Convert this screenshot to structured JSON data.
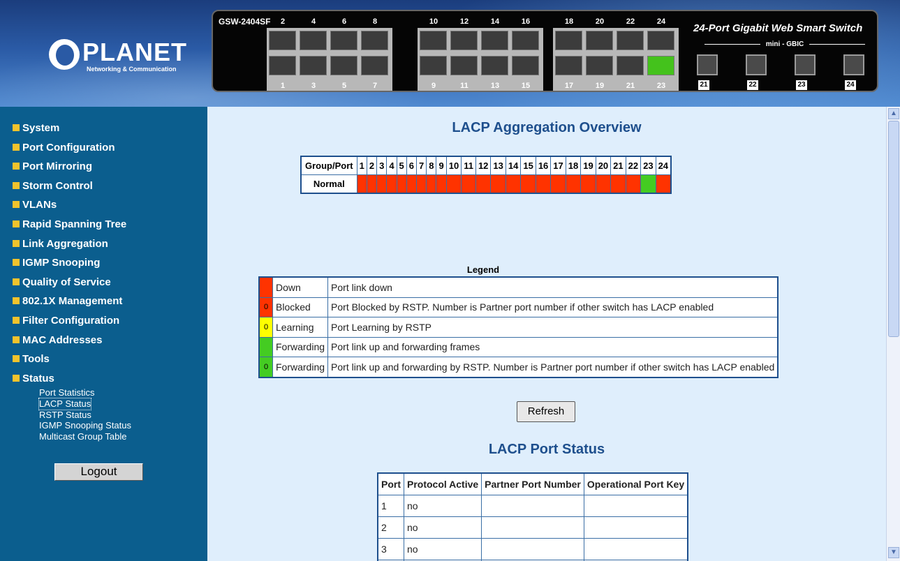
{
  "brand": {
    "logo_text": "PLANET",
    "logo_tagline": "Networking & Communication"
  },
  "device": {
    "model": "GSW-2404SF",
    "title": "24-Port Gigabit Web Smart Switch",
    "mini_gbic_label": "mini - GBIC",
    "top_ports": [
      "2",
      "4",
      "6",
      "8",
      "10",
      "12",
      "14",
      "16",
      "18",
      "20",
      "22",
      "24"
    ],
    "bottom_ports": [
      "1",
      "3",
      "5",
      "7",
      "9",
      "11",
      "13",
      "15",
      "17",
      "19",
      "21",
      "23"
    ],
    "sfp_ports": [
      "21",
      "22",
      "23",
      "24"
    ]
  },
  "menu": {
    "items": [
      "System",
      "Port Configuration",
      "Port Mirroring",
      "Storm Control",
      "VLANs",
      "Rapid Spanning Tree",
      "Link Aggregation",
      "IGMP Snooping",
      "Quality of Service",
      "802.1X Management",
      "Filter Configuration",
      "MAC Addresses",
      "Tools",
      "Status"
    ],
    "status_sub": [
      "Port Statistics",
      "LACP Status",
      "RSTP Status",
      "IGMP Snooping Status",
      "Multicast Group Table"
    ],
    "logout": "Logout"
  },
  "overview": {
    "title": "LACP Aggregation Overview",
    "header_label": "Group/Port",
    "ports": [
      "1",
      "2",
      "3",
      "4",
      "5",
      "6",
      "7",
      "8",
      "9",
      "10",
      "11",
      "12",
      "13",
      "14",
      "15",
      "16",
      "17",
      "18",
      "19",
      "20",
      "21",
      "22",
      "23",
      "24"
    ],
    "row_label": "Normal",
    "states": [
      "down",
      "down",
      "down",
      "down",
      "down",
      "down",
      "down",
      "down",
      "down",
      "down",
      "down",
      "down",
      "down",
      "down",
      "down",
      "down",
      "down",
      "down",
      "down",
      "down",
      "down",
      "down",
      "up",
      "down"
    ],
    "colors": {
      "down": "#ff3300",
      "up": "#44cc22",
      "learning": "#ffff00"
    }
  },
  "legend": {
    "title": "Legend",
    "rows": [
      {
        "swatch": "",
        "color": "#ff3300",
        "state": "Down",
        "desc": "Port link down"
      },
      {
        "swatch": "0",
        "color": "#ffffff",
        "state": "Blocked",
        "desc": "Port Blocked by RSTP. Number is Partner port number if other switch has LACP enabled"
      },
      {
        "swatch": "0",
        "color": "#ffff00",
        "state": "Learning",
        "desc": "Port Learning by RSTP"
      },
      {
        "swatch": "",
        "color": "#44cc22",
        "state": "Forwarding",
        "desc": "Port link up and forwarding frames"
      },
      {
        "swatch": "0",
        "color": "#44cc22",
        "state": "Forwarding",
        "desc": "Port link up and forwarding by RSTP. Number is Partner port number if other switch has LACP enabled"
      }
    ]
  },
  "refresh_label": "Refresh",
  "port_status": {
    "title": "LACP Port Status",
    "headers": [
      "Port",
      "Protocol Active",
      "Partner Port Number",
      "Operational Port Key"
    ],
    "rows": [
      [
        "1",
        "no",
        "",
        ""
      ],
      [
        "2",
        "no",
        "",
        ""
      ],
      [
        "3",
        "no",
        "",
        ""
      ]
    ]
  }
}
